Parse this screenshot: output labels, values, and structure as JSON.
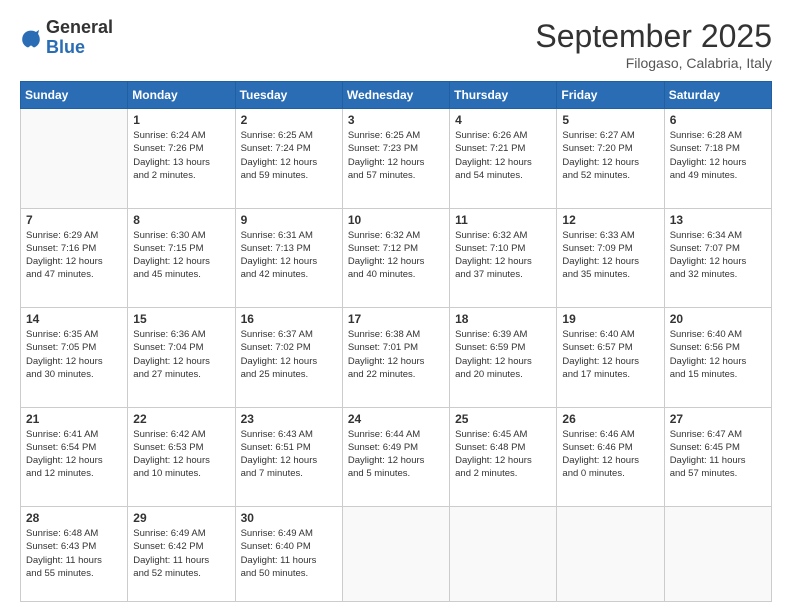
{
  "logo": {
    "general": "General",
    "blue": "Blue"
  },
  "header": {
    "month": "September 2025",
    "location": "Filogaso, Calabria, Italy"
  },
  "weekdays": [
    "Sunday",
    "Monday",
    "Tuesday",
    "Wednesday",
    "Thursday",
    "Friday",
    "Saturday"
  ],
  "weeks": [
    [
      {
        "day": "",
        "info": ""
      },
      {
        "day": "1",
        "info": "Sunrise: 6:24 AM\nSunset: 7:26 PM\nDaylight: 13 hours\nand 2 minutes."
      },
      {
        "day": "2",
        "info": "Sunrise: 6:25 AM\nSunset: 7:24 PM\nDaylight: 12 hours\nand 59 minutes."
      },
      {
        "day": "3",
        "info": "Sunrise: 6:25 AM\nSunset: 7:23 PM\nDaylight: 12 hours\nand 57 minutes."
      },
      {
        "day": "4",
        "info": "Sunrise: 6:26 AM\nSunset: 7:21 PM\nDaylight: 12 hours\nand 54 minutes."
      },
      {
        "day": "5",
        "info": "Sunrise: 6:27 AM\nSunset: 7:20 PM\nDaylight: 12 hours\nand 52 minutes."
      },
      {
        "day": "6",
        "info": "Sunrise: 6:28 AM\nSunset: 7:18 PM\nDaylight: 12 hours\nand 49 minutes."
      }
    ],
    [
      {
        "day": "7",
        "info": "Sunrise: 6:29 AM\nSunset: 7:16 PM\nDaylight: 12 hours\nand 47 minutes."
      },
      {
        "day": "8",
        "info": "Sunrise: 6:30 AM\nSunset: 7:15 PM\nDaylight: 12 hours\nand 45 minutes."
      },
      {
        "day": "9",
        "info": "Sunrise: 6:31 AM\nSunset: 7:13 PM\nDaylight: 12 hours\nand 42 minutes."
      },
      {
        "day": "10",
        "info": "Sunrise: 6:32 AM\nSunset: 7:12 PM\nDaylight: 12 hours\nand 40 minutes."
      },
      {
        "day": "11",
        "info": "Sunrise: 6:32 AM\nSunset: 7:10 PM\nDaylight: 12 hours\nand 37 minutes."
      },
      {
        "day": "12",
        "info": "Sunrise: 6:33 AM\nSunset: 7:09 PM\nDaylight: 12 hours\nand 35 minutes."
      },
      {
        "day": "13",
        "info": "Sunrise: 6:34 AM\nSunset: 7:07 PM\nDaylight: 12 hours\nand 32 minutes."
      }
    ],
    [
      {
        "day": "14",
        "info": "Sunrise: 6:35 AM\nSunset: 7:05 PM\nDaylight: 12 hours\nand 30 minutes."
      },
      {
        "day": "15",
        "info": "Sunrise: 6:36 AM\nSunset: 7:04 PM\nDaylight: 12 hours\nand 27 minutes."
      },
      {
        "day": "16",
        "info": "Sunrise: 6:37 AM\nSunset: 7:02 PM\nDaylight: 12 hours\nand 25 minutes."
      },
      {
        "day": "17",
        "info": "Sunrise: 6:38 AM\nSunset: 7:01 PM\nDaylight: 12 hours\nand 22 minutes."
      },
      {
        "day": "18",
        "info": "Sunrise: 6:39 AM\nSunset: 6:59 PM\nDaylight: 12 hours\nand 20 minutes."
      },
      {
        "day": "19",
        "info": "Sunrise: 6:40 AM\nSunset: 6:57 PM\nDaylight: 12 hours\nand 17 minutes."
      },
      {
        "day": "20",
        "info": "Sunrise: 6:40 AM\nSunset: 6:56 PM\nDaylight: 12 hours\nand 15 minutes."
      }
    ],
    [
      {
        "day": "21",
        "info": "Sunrise: 6:41 AM\nSunset: 6:54 PM\nDaylight: 12 hours\nand 12 minutes."
      },
      {
        "day": "22",
        "info": "Sunrise: 6:42 AM\nSunset: 6:53 PM\nDaylight: 12 hours\nand 10 minutes."
      },
      {
        "day": "23",
        "info": "Sunrise: 6:43 AM\nSunset: 6:51 PM\nDaylight: 12 hours\nand 7 minutes."
      },
      {
        "day": "24",
        "info": "Sunrise: 6:44 AM\nSunset: 6:49 PM\nDaylight: 12 hours\nand 5 minutes."
      },
      {
        "day": "25",
        "info": "Sunrise: 6:45 AM\nSunset: 6:48 PM\nDaylight: 12 hours\nand 2 minutes."
      },
      {
        "day": "26",
        "info": "Sunrise: 6:46 AM\nSunset: 6:46 PM\nDaylight: 12 hours\nand 0 minutes."
      },
      {
        "day": "27",
        "info": "Sunrise: 6:47 AM\nSunset: 6:45 PM\nDaylight: 11 hours\nand 57 minutes."
      }
    ],
    [
      {
        "day": "28",
        "info": "Sunrise: 6:48 AM\nSunset: 6:43 PM\nDaylight: 11 hours\nand 55 minutes."
      },
      {
        "day": "29",
        "info": "Sunrise: 6:49 AM\nSunset: 6:42 PM\nDaylight: 11 hours\nand 52 minutes."
      },
      {
        "day": "30",
        "info": "Sunrise: 6:49 AM\nSunset: 6:40 PM\nDaylight: 11 hours\nand 50 minutes."
      },
      {
        "day": "",
        "info": ""
      },
      {
        "day": "",
        "info": ""
      },
      {
        "day": "",
        "info": ""
      },
      {
        "day": "",
        "info": ""
      }
    ]
  ]
}
